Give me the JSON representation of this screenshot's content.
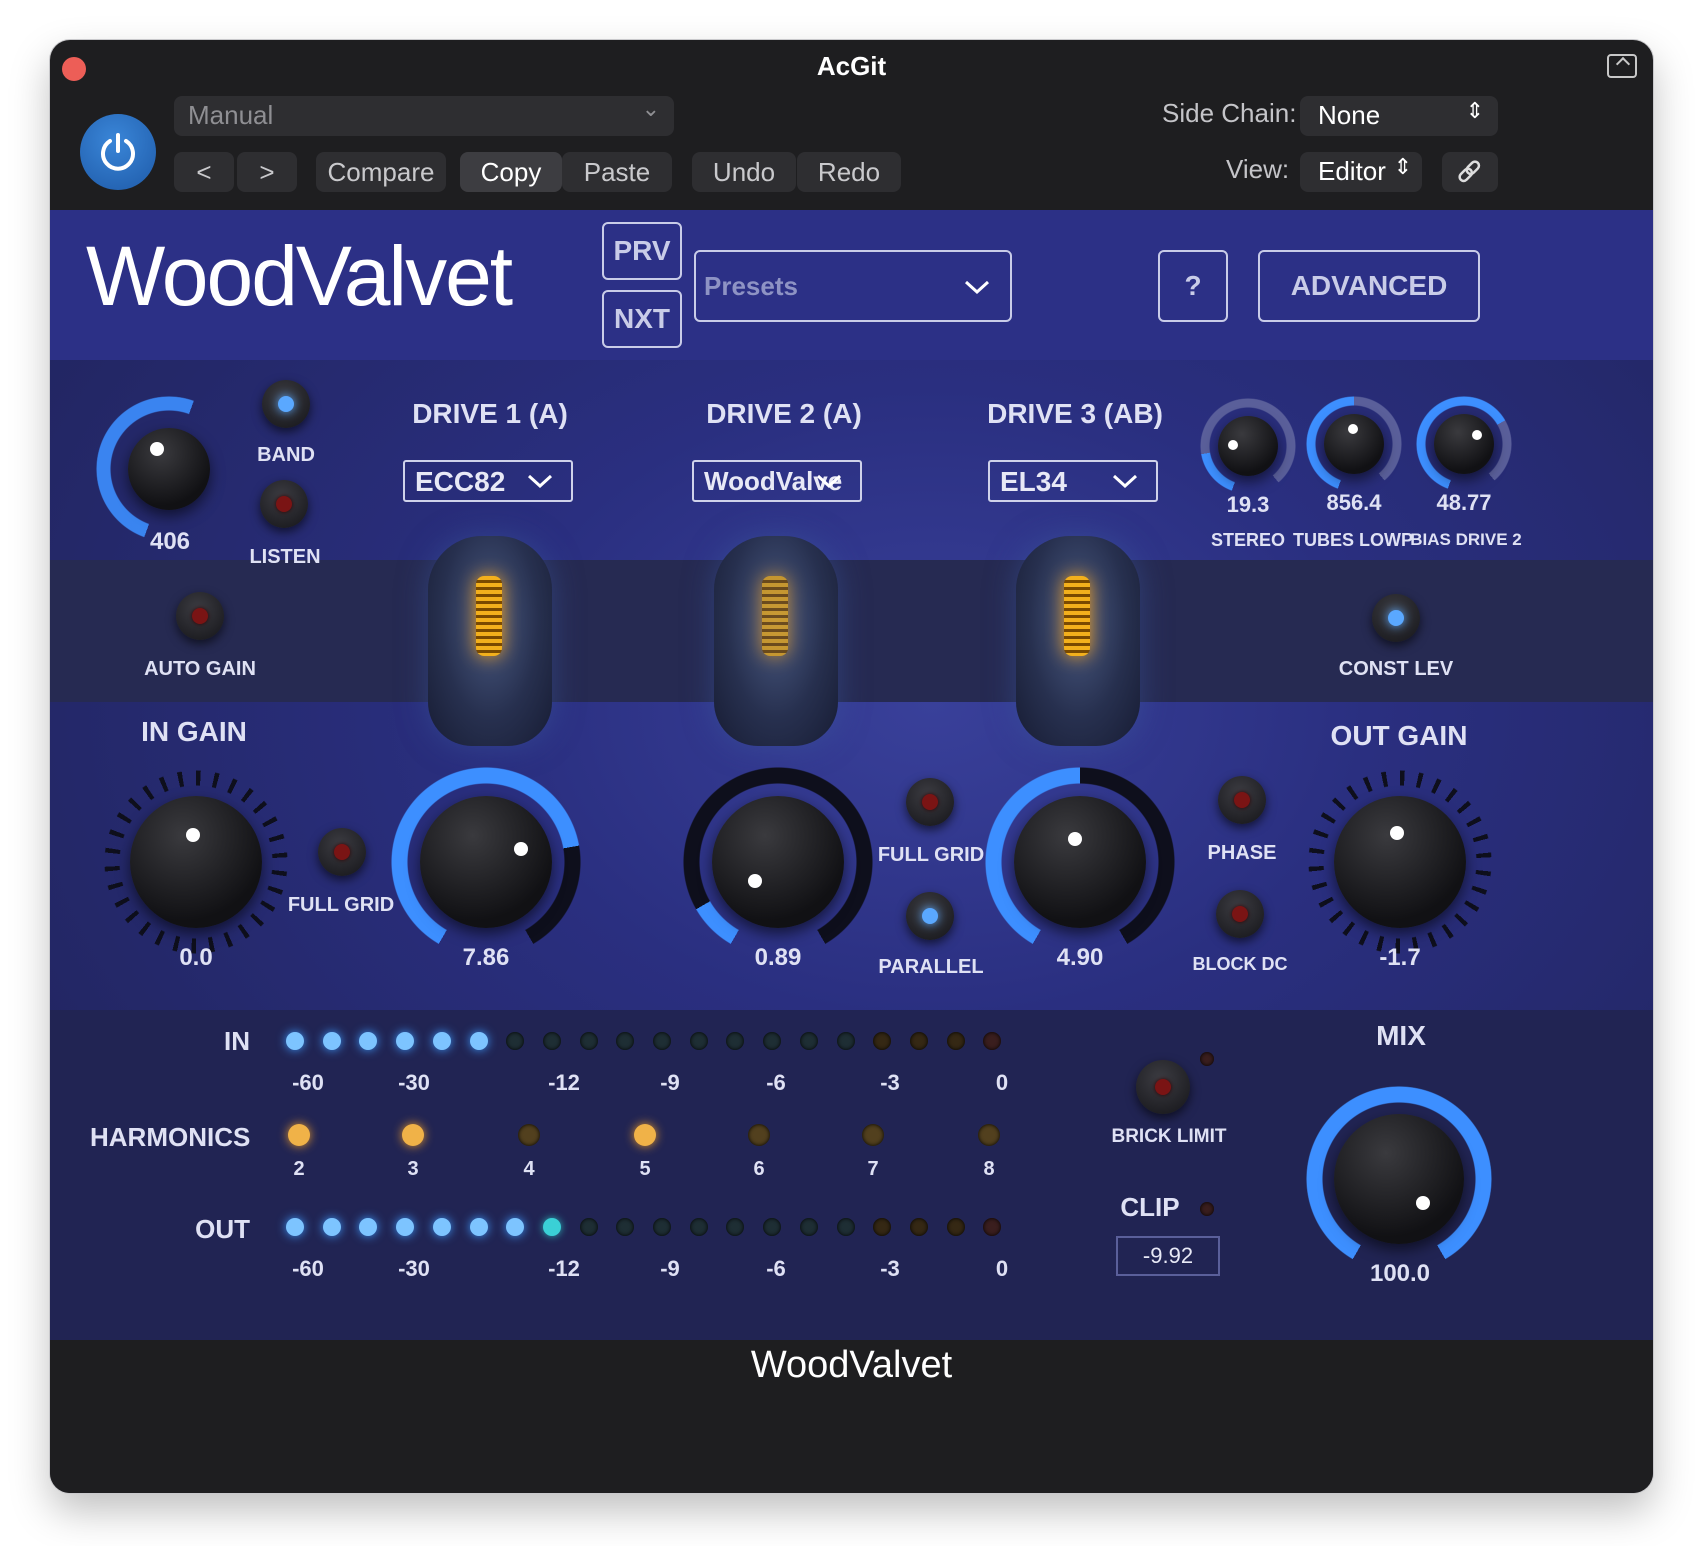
{
  "window": {
    "title": "AcGit"
  },
  "toolbar": {
    "preset_value": "Manual",
    "compare": "Compare",
    "copy": "Copy",
    "paste": "Paste",
    "undo": "Undo",
    "redo": "Redo",
    "side_chain_label": "Side Chain:",
    "side_chain_value": "None",
    "view_label": "View:",
    "view_value": "Editor"
  },
  "plugin": {
    "logo": "WoodValvet",
    "prv": "PRV",
    "nxt": "NXT",
    "presets": "Presets",
    "help": "?",
    "advanced": "ADVANCED"
  },
  "controls": {
    "band_knob_value": "406",
    "band": "BAND",
    "listen": "LISTEN",
    "auto_gain": "AUTO GAIN",
    "drive1_title": "DRIVE 1 (A)",
    "drive2_title": "DRIVE 2 (A)",
    "drive3_title": "DRIVE 3 (AB)",
    "drive1_tube": "ECC82",
    "drive2_tube": "WoodValve",
    "drive3_tube": "EL34",
    "stereo_value": "19.3",
    "stereo": "STEREO",
    "tubes_lowp_value": "856.4",
    "tubes_lowp": "TUBES LOWP",
    "bias_drive2_value": "48.77",
    "bias_drive2": "BIAS DRIVE 2",
    "const_lev": "CONST LEV",
    "in_gain": "IN GAIN",
    "in_gain_value": "0.0",
    "full_grid_1": "FULL GRID",
    "drive1_value": "7.86",
    "drive2_value": "0.89",
    "full_grid_2": "FULL GRID",
    "parallel": "PARALLEL",
    "drive3_value": "4.90",
    "phase": "PHASE",
    "block_dc": "BLOCK DC",
    "out_gain": "OUT GAIN",
    "out_gain_value": "-1.7"
  },
  "meters": {
    "in_label": "IN",
    "out_label": "OUT",
    "harmonics_label": "HARMONICS",
    "scale": [
      "-60",
      "-30",
      "-12",
      "-9",
      "-6",
      "-3",
      "0"
    ],
    "harmonics": [
      "2",
      "3",
      "4",
      "5",
      "6",
      "7",
      "8"
    ],
    "brick_limit": "BRICK LIMIT",
    "clip": "CLIP",
    "clip_value": "-9.92",
    "mix": "MIX",
    "mix_value": "100.0"
  },
  "footer": {
    "title": "WoodValvet"
  },
  "colors": {
    "accent_blue": "#5aa8ff",
    "plugin_bg": "#2c3086",
    "amber": "#f0b248"
  }
}
